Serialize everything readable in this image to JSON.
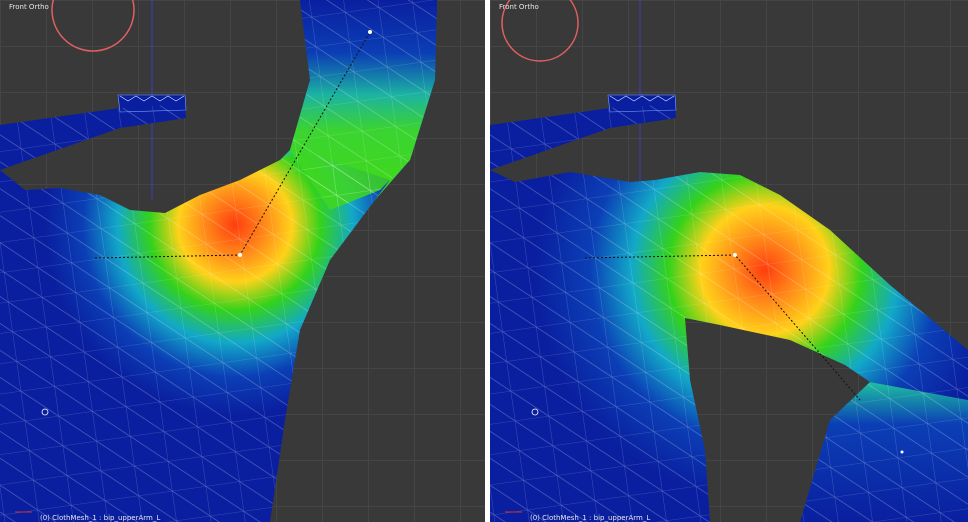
{
  "colors": {
    "background": "#393939",
    "grid": "#454545",
    "mesh_blue": "#0a1fa8",
    "heat_red": "#ff4a12",
    "heat_yellow": "#ffd21a",
    "heat_green": "#1fcf1a",
    "cursor_ring": "#e06060"
  },
  "viewports": [
    {
      "view_label": "Front Ortho",
      "object_label": "(0) ClothMesh_1 : bip_upperArm_L"
    },
    {
      "view_label": "Front Ortho",
      "object_label": "(0) ClothMesh_1 : bip_upperArm_L"
    }
  ]
}
